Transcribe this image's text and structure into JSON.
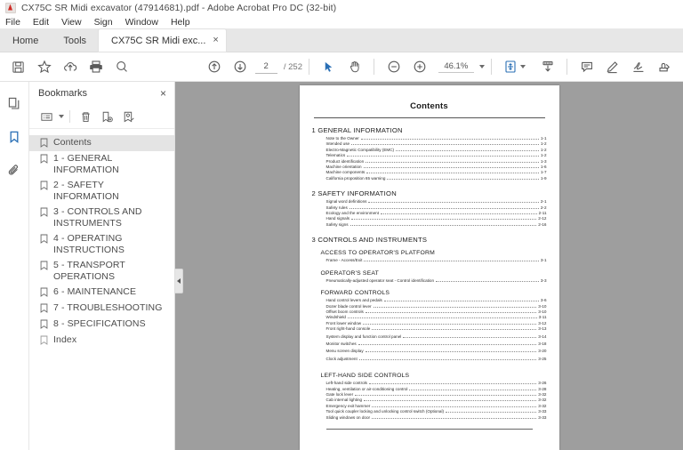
{
  "window": {
    "title": "CX75C SR Midi excavator (47914681).pdf - Adobe Acrobat Pro DC (32-bit)",
    "app_icon": "acrobat-icon"
  },
  "menubar": {
    "items": [
      "File",
      "Edit",
      "View",
      "Sign",
      "Window",
      "Help"
    ]
  },
  "tabs": {
    "home": "Home",
    "tools": "Tools",
    "document": "CX75C SR Midi exc...",
    "close_glyph": "×"
  },
  "toolbar": {
    "left_tools": [
      {
        "name": "save-icon",
        "tooltip": "Save"
      },
      {
        "name": "star-icon",
        "tooltip": "Add to favorites"
      },
      {
        "name": "cloud-upload-icon",
        "tooltip": "Upload"
      },
      {
        "name": "print-icon",
        "tooltip": "Print"
      },
      {
        "name": "search-icon",
        "tooltip": "Find"
      }
    ],
    "nav": {
      "prev_icon": "arrow-up-circle-icon",
      "next_icon": "arrow-down-circle-icon",
      "current_page": "2",
      "page_separator": "/",
      "total_pages": "252"
    },
    "cursor_tools": [
      {
        "name": "select-cursor-icon",
        "active": true
      },
      {
        "name": "hand-tool-icon",
        "active": false
      }
    ],
    "zoom": {
      "out_icon": "zoom-out-icon",
      "in_icon": "zoom-in-icon",
      "level": "46.1%",
      "dropdown_icon": "chevron-down-icon"
    },
    "view_tools": [
      {
        "name": "fit-page-icon"
      },
      {
        "name": "scroll-mode-icon"
      }
    ],
    "right_tools": [
      {
        "name": "comment-icon"
      },
      {
        "name": "highlight-icon"
      },
      {
        "name": "sign-icon"
      },
      {
        "name": "stamp-icon"
      }
    ],
    "accent_color": "#2a6fb5"
  },
  "rail": {
    "items": [
      {
        "name": "page-thumbnails-icon",
        "active": false
      },
      {
        "name": "bookmarks-icon",
        "active": true
      },
      {
        "name": "attachments-icon",
        "active": false
      }
    ]
  },
  "bookmarks": {
    "panel_title": "Bookmarks",
    "close_glyph": "×",
    "toolbar": [
      {
        "name": "options-list-icon"
      },
      {
        "name": "delete-bookmark-icon"
      },
      {
        "name": "new-bookmark-icon"
      },
      {
        "name": "edit-bookmark-icon"
      }
    ],
    "items": [
      {
        "label": "Contents",
        "selected": true
      },
      {
        "label": "1 - GENERAL INFORMATION",
        "selected": false
      },
      {
        "label": "2 - SAFETY INFORMATION",
        "selected": false
      },
      {
        "label": "3 - CONTROLS AND INSTRUMENTS",
        "selected": false
      },
      {
        "label": "4 - OPERATING INSTRUCTIONS",
        "selected": false
      },
      {
        "label": "5 - TRANSPORT OPERATIONS",
        "selected": false
      },
      {
        "label": "6 - MAINTENANCE",
        "selected": false
      },
      {
        "label": "7 - TROUBLESHOOTING",
        "selected": false
      },
      {
        "label": "8 - SPECIFICATIONS",
        "selected": false
      },
      {
        "label": "Index",
        "selected": false
      }
    ]
  },
  "document": {
    "page_title": "Contents",
    "sections": [
      {
        "heading": "1 GENERAL INFORMATION",
        "level": 1,
        "entries": [
          {
            "title": "Note to the Owner",
            "page": "1-1"
          },
          {
            "title": "Intended use",
            "page": "1-2"
          },
          {
            "title": "Electro-Magnetic Compatibility (EMC)",
            "page": "1-2"
          },
          {
            "title": "Telematics",
            "page": "1-2"
          },
          {
            "title": "Product identification",
            "page": "1-3"
          },
          {
            "title": "Machine orientation",
            "page": "1-6"
          },
          {
            "title": "Machine components",
            "page": "1-7"
          },
          {
            "title": "California proposition 65 warning",
            "page": "1-9"
          }
        ]
      },
      {
        "heading": "2 SAFETY INFORMATION",
        "level": 1,
        "entries": [
          {
            "title": "Signal word definitions",
            "page": "2-1"
          },
          {
            "title": "Safety rules",
            "page": "2-2"
          },
          {
            "title": "Ecology and the environment",
            "page": "2-11"
          },
          {
            "title": "Hand signals",
            "page": "2-12"
          },
          {
            "title": "Safety signs",
            "page": "2-16"
          }
        ]
      },
      {
        "heading": "3 CONTROLS AND INSTRUMENTS",
        "level": 1,
        "entries": []
      },
      {
        "heading": "ACCESS TO OPERATOR'S PLATFORM",
        "level": 2,
        "entries": [
          {
            "title": "Frame - Access/Exit",
            "page": "3-1"
          }
        ]
      },
      {
        "heading": "OPERATOR'S SEAT",
        "level": 2,
        "entries": [
          {
            "title": "Pneumatically-adjusted operator seat - Control identification",
            "page": "3-3"
          }
        ]
      },
      {
        "heading": "FORWARD CONTROLS",
        "level": 2,
        "entries": [
          {
            "title": "Hand control levers and pedals",
            "page": "3-6"
          },
          {
            "title": "Dozer blade control lever",
            "page": "3-10"
          },
          {
            "title": "Offset boom controls",
            "page": "3-10"
          },
          {
            "title": "Windshield",
            "page": "3-11"
          },
          {
            "title": "Front lower window",
            "page": "3-12"
          },
          {
            "title": "Front right-hand console",
            "page": "3-13"
          },
          {
            "title": "System display and function control panel",
            "page": "3-14"
          },
          {
            "title": "Monitor switches",
            "page": "3-18"
          },
          {
            "title": "Menu screen display",
            "page": "3-20"
          },
          {
            "title": "Clock adjustment",
            "page": "3-25"
          }
        ]
      },
      {
        "heading": "LEFT-HAND SIDE CONTROLS",
        "level": 2,
        "entries": [
          {
            "title": "Left-hand side controls",
            "page": "3-26"
          },
          {
            "title": "Heating, ventilation or air-conditioning control",
            "page": "3-28"
          },
          {
            "title": "Gate lock lever",
            "page": "3-32"
          },
          {
            "title": "Cab internal lighting",
            "page": "3-32"
          },
          {
            "title": "Emergency exit hammer",
            "page": "3-32"
          },
          {
            "title": "Tool quick coupler locking and unlocking control switch (Optional)",
            "page": "3-33"
          },
          {
            "title": "Sliding windows on door",
            "page": "3-33"
          }
        ]
      }
    ]
  }
}
